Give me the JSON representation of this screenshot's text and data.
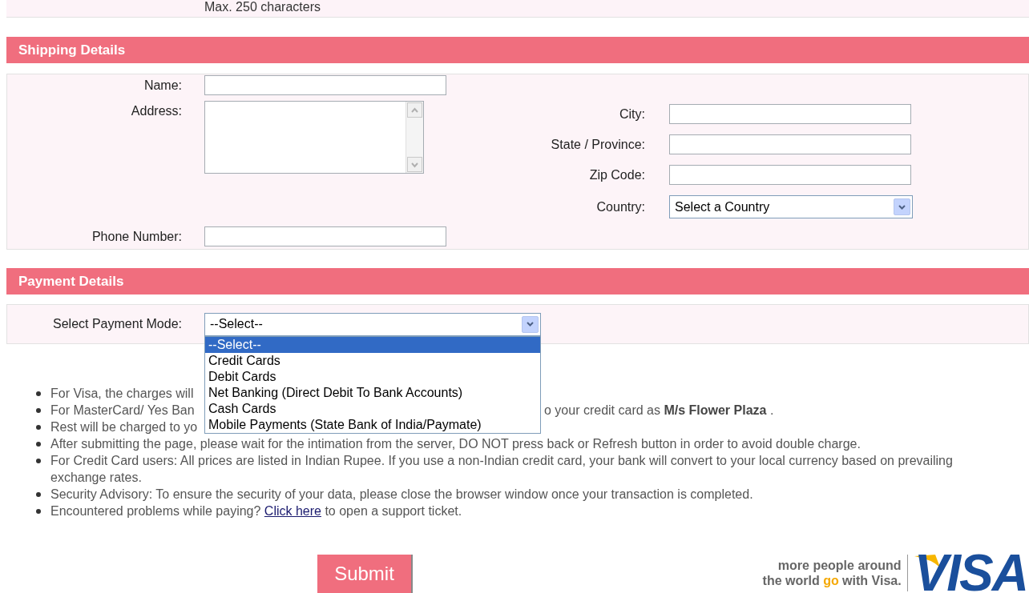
{
  "top_note": "Max. 250 characters",
  "shipping": {
    "title": "Shipping Details",
    "left_fields": [
      {
        "label": "Name:",
        "kind": "text"
      },
      {
        "label": "Address:",
        "kind": "textarea"
      },
      {
        "label": "Phone Number:",
        "kind": "text"
      }
    ],
    "right_fields": [
      {
        "label": "City:",
        "kind": "text"
      },
      {
        "label": "State / Province:",
        "kind": "text"
      },
      {
        "label": "Zip Code:",
        "kind": "text"
      },
      {
        "label": "Country:",
        "kind": "select",
        "value": "Select a Country"
      }
    ]
  },
  "payment": {
    "title": "Payment Details",
    "label": "Select Payment Mode:",
    "value": "--Select--",
    "expanded": true,
    "options": [
      {
        "label": "--Select--",
        "selected": true
      },
      {
        "label": "Credit Cards",
        "selected": false
      },
      {
        "label": "Debit Cards",
        "selected": false
      },
      {
        "label": "Net Banking (Direct Debit To Bank Accounts)",
        "selected": false
      },
      {
        "label": "Cash Cards",
        "selected": false
      },
      {
        "label": "Mobile Payments (State Bank of India/Paymate)",
        "selected": false
      }
    ]
  },
  "notes": [
    {
      "segments": [
        {
          "kind": "text",
          "text": "For Visa, the charges will"
        }
      ]
    },
    {
      "segments": [
        {
          "kind": "text",
          "text": "For MasterCard/ Yes Ban"
        },
        {
          "kind": "after_dropdown",
          "text": "o your credit card as **M/s Flower Plaza** ."
        }
      ]
    },
    {
      "segments": [
        {
          "kind": "text",
          "text": "Rest will be charged to yo"
        }
      ]
    },
    {
      "segments": [
        {
          "kind": "text",
          "text": "After submitting the page, please wait for the intimation from the server, DO NOT press back or Refresh button in order to avoid double charge."
        }
      ]
    },
    {
      "segments": [
        {
          "kind": "text",
          "text": "For Credit Card users: All prices are listed in Indian Rupee. If you use a non-Indian credit card, your bank will convert to your local currency based on prevailing exchange rates."
        }
      ]
    },
    {
      "segments": [
        {
          "kind": "text",
          "text": "Security Advisory: To ensure the security of your data, please close the browser window once your transaction is completed."
        }
      ]
    },
    {
      "segments": [
        {
          "kind": "text",
          "text": "Encountered problems while paying? "
        },
        {
          "kind": "link",
          "text": "Click here"
        },
        {
          "kind": "text",
          "text": " to open a support ticket."
        }
      ]
    }
  ],
  "submit": "Submit",
  "visa": {
    "tagline": [
      [
        {
          "text": "more people around",
          "highlight": false
        }
      ],
      [
        {
          "text": "the world ",
          "highlight": false
        },
        {
          "text": "go",
          "highlight": true
        },
        {
          "text": " with Visa.",
          "highlight": false
        }
      ]
    ],
    "logo": "VISA"
  }
}
